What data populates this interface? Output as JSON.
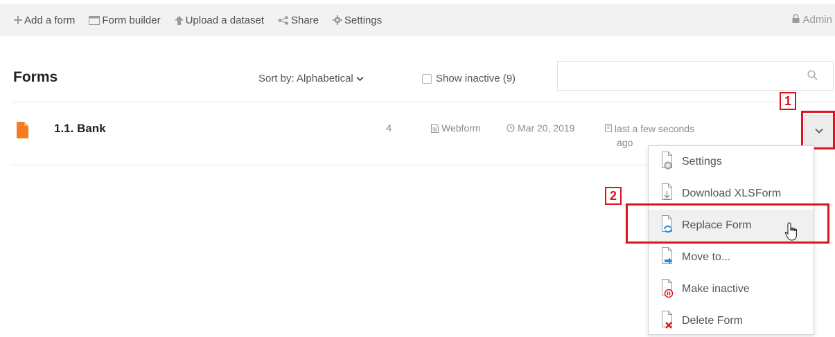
{
  "topbar": {
    "items": [
      {
        "label": "Add a form",
        "icon": "plus-icon"
      },
      {
        "label": "Form builder",
        "icon": "form-builder-icon"
      },
      {
        "label": "Upload a dataset",
        "icon": "upload-icon"
      },
      {
        "label": "Share",
        "icon": "share-icon"
      },
      {
        "label": "Settings",
        "icon": "gear-icon"
      }
    ],
    "admin_label": "Admin"
  },
  "toolbar": {
    "title": "Forms",
    "sort_label": "Sort by: Alphabetical",
    "show_inactive_label": "Show inactive (9)",
    "search_placeholder": ""
  },
  "forms": [
    {
      "name": "1.1. Bank",
      "count": "4",
      "type": "Webform",
      "date": "Mar 20, 2019",
      "last_modified_line1": "last a few seconds",
      "last_modified_line2": "ago"
    }
  ],
  "dropdown_menu": {
    "items": [
      {
        "label": "Settings",
        "icon": "settings-file-icon"
      },
      {
        "label": "Download XLSForm",
        "icon": "download-file-icon"
      },
      {
        "label": "Replace Form",
        "icon": "replace-file-icon"
      },
      {
        "label": "Move to...",
        "icon": "move-file-icon"
      },
      {
        "label": "Make inactive",
        "icon": "inactive-file-icon"
      },
      {
        "label": "Delete Form",
        "icon": "delete-file-icon"
      }
    ]
  },
  "annotations": {
    "callout_1": "1",
    "callout_2": "2",
    "color": "#e0101c"
  },
  "colors": {
    "accent_orange": "#f47c20",
    "topbar_bg": "#f2f2f2"
  }
}
